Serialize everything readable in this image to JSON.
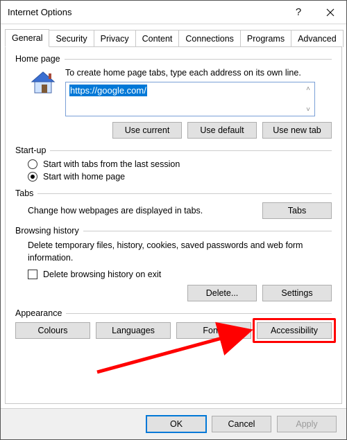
{
  "window": {
    "title": "Internet Options"
  },
  "tabs": {
    "items": [
      "General",
      "Security",
      "Privacy",
      "Content",
      "Connections",
      "Programs",
      "Advanced"
    ],
    "active": 0
  },
  "homepage": {
    "legend": "Home page",
    "hint": "To create home page tabs, type each address on its own line.",
    "url_value": "https://google.com/",
    "buttons": {
      "use_current": "Use current",
      "use_default": "Use default",
      "use_new_tab": "Use new tab"
    }
  },
  "startup": {
    "legend": "Start-up",
    "option_last": "Start with tabs from the last session",
    "option_home": "Start with home page",
    "selected": "home"
  },
  "tabs_group": {
    "legend": "Tabs",
    "hint": "Change how webpages are displayed in tabs.",
    "button": "Tabs"
  },
  "history": {
    "legend": "Browsing history",
    "hint": "Delete temporary files, history, cookies, saved passwords and web form information.",
    "checkbox_label": "Delete browsing history on exit",
    "checkbox_checked": false,
    "buttons": {
      "delete": "Delete...",
      "settings": "Settings"
    }
  },
  "appearance": {
    "legend": "Appearance",
    "buttons": {
      "colours": "Colours",
      "languages": "Languages",
      "fonts": "Fonts",
      "accessibility": "Accessibility"
    }
  },
  "footer": {
    "ok": "OK",
    "cancel": "Cancel",
    "apply": "Apply"
  },
  "annotation": {
    "highlight_target": "accessibility-button"
  }
}
